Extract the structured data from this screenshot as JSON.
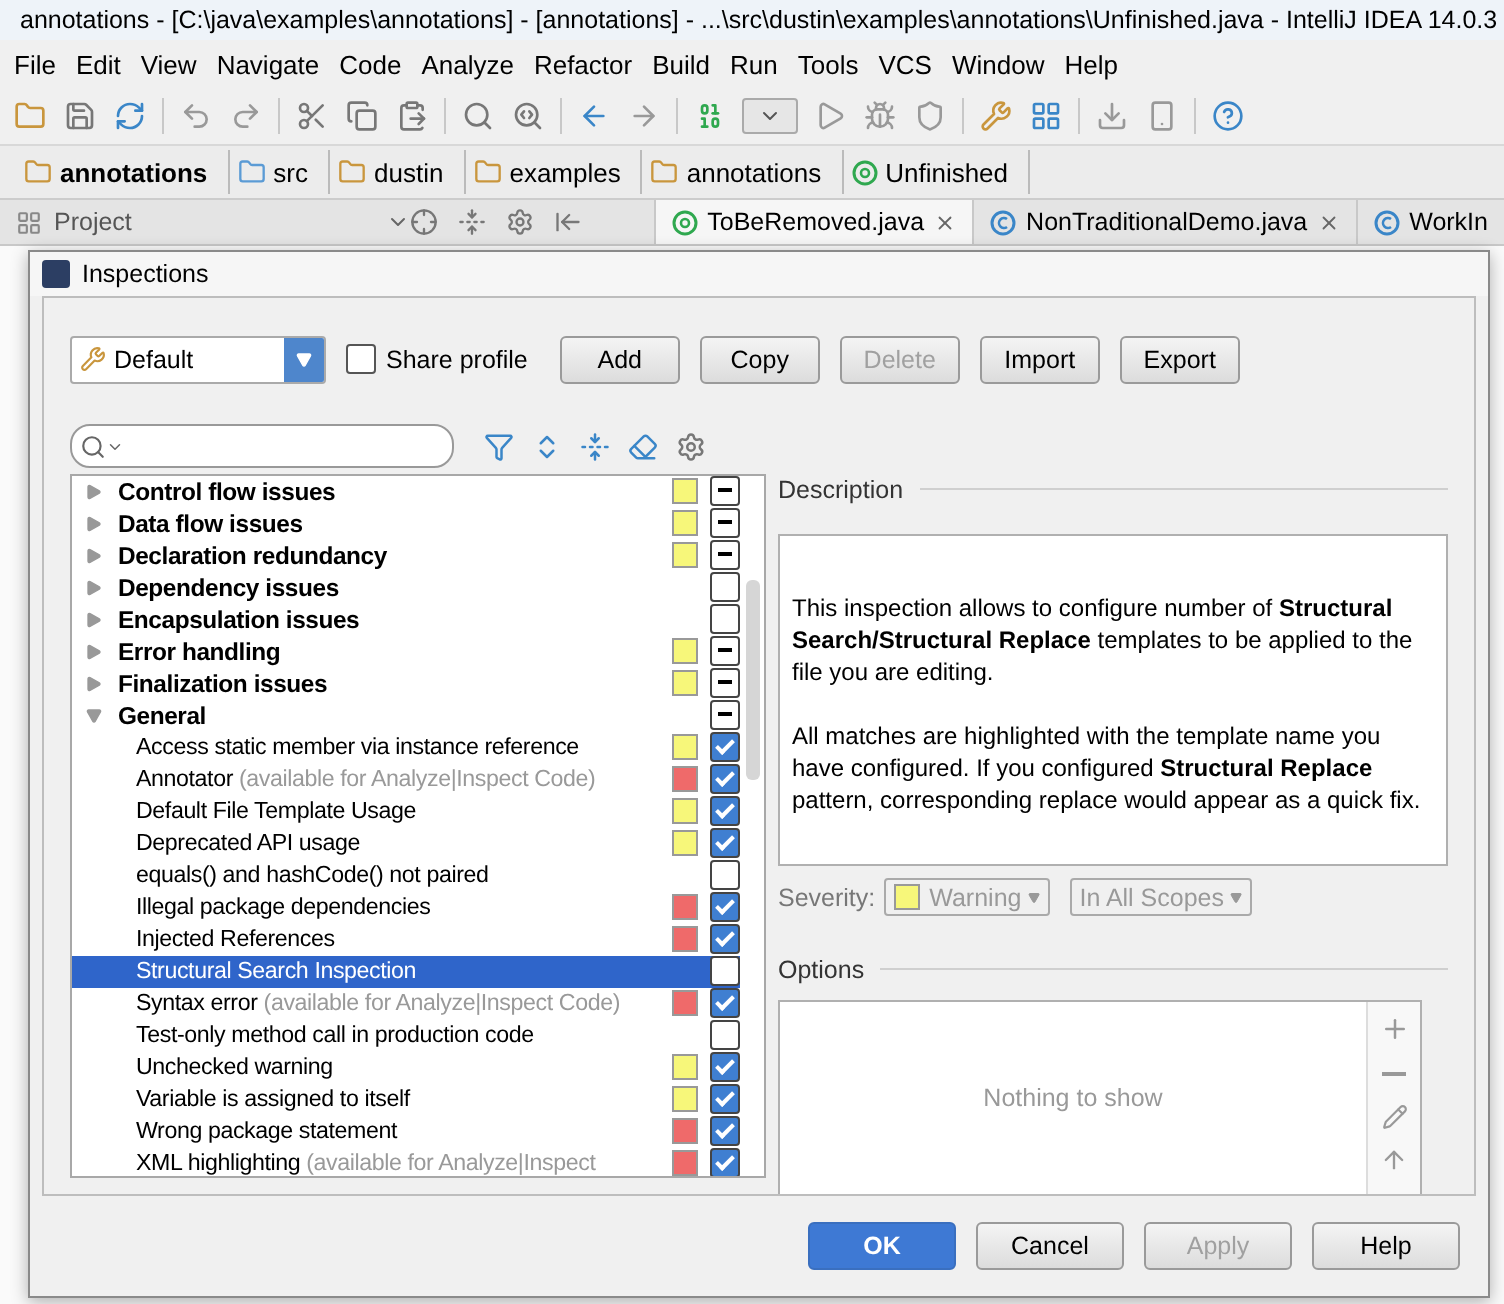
{
  "window": {
    "title": "annotations - [C:\\java\\examples\\annotations] - [annotations] - ...\\src\\dustin\\examples\\annotations\\Unfinished.java - IntelliJ IDEA 14.0.3"
  },
  "menu": [
    "File",
    "Edit",
    "View",
    "Navigate",
    "Code",
    "Analyze",
    "Refactor",
    "Build",
    "Run",
    "Tools",
    "VCS",
    "Window",
    "Help"
  ],
  "breadcrumbs": [
    {
      "label": "annotations",
      "kind": "module"
    },
    {
      "label": "src",
      "kind": "source"
    },
    {
      "label": "dustin",
      "kind": "package"
    },
    {
      "label": "examples",
      "kind": "package"
    },
    {
      "label": "annotations",
      "kind": "package"
    },
    {
      "label": "Unfinished",
      "kind": "annotation"
    }
  ],
  "tool_window": {
    "title": "Project"
  },
  "editor_tabs": [
    {
      "label": "ToBeRemoved.java",
      "kind": "annotation",
      "selected": true
    },
    {
      "label": "NonTraditionalDemo.java",
      "kind": "class",
      "selected": false
    },
    {
      "label": "WorkIn",
      "kind": "class",
      "selected": false
    }
  ],
  "dialog": {
    "title": "Inspections",
    "profile": {
      "value": "Default"
    },
    "share_profile": {
      "label": "Share profile",
      "checked": false
    },
    "buttons": [
      {
        "label": "Add",
        "disabled": false
      },
      {
        "label": "Copy",
        "disabled": false
      },
      {
        "label": "Delete",
        "disabled": true
      },
      {
        "label": "Import",
        "disabled": false
      },
      {
        "label": "Export",
        "disabled": false
      }
    ],
    "tree": [
      {
        "label": "Control flow issues",
        "expanded": false,
        "selected": false,
        "color": "#f7f77a",
        "mixed": true
      },
      {
        "label": "Data flow issues",
        "expanded": false,
        "selected": false,
        "color": "#f7f77a",
        "mixed": true
      },
      {
        "label": "Declaration redundancy",
        "expanded": false,
        "selected": false,
        "color": "#f7f77a",
        "mixed": true
      },
      {
        "label": "Dependency issues",
        "expanded": false,
        "selected": false,
        "mixed": false
      },
      {
        "label": "Encapsulation issues",
        "expanded": false,
        "selected": false,
        "mixed": false
      },
      {
        "label": "Error handling",
        "expanded": false,
        "selected": false,
        "color": "#f7f77a",
        "mixed": true
      },
      {
        "label": "Finalization issues",
        "expanded": false,
        "selected": false,
        "color": "#f7f77a",
        "mixed": true
      },
      {
        "label": "General",
        "expanded": true,
        "selected": false,
        "mixed": true,
        "children": [
          {
            "label": "Access static member via instance reference",
            "selected": false,
            "color": "#f7f77a",
            "checked": true
          },
          {
            "label": "Annotator",
            "note": "(available for Analyze|Inspect Code)",
            "selected": false,
            "color": "#ef6a6a",
            "checked": true
          },
          {
            "label": "Default File Template Usage",
            "selected": false,
            "color": "#f7f77a",
            "checked": true
          },
          {
            "label": "Deprecated API usage",
            "selected": false,
            "color": "#f7f77a",
            "checked": true
          },
          {
            "label": "equals() and hashCode() not paired",
            "selected": false,
            "checked": false
          },
          {
            "label": "Illegal package dependencies",
            "selected": false,
            "color": "#ef6a6a",
            "checked": true
          },
          {
            "label": "Injected References",
            "selected": false,
            "color": "#ef6a6a",
            "checked": true
          },
          {
            "label": "Structural Search Inspection",
            "selected": true,
            "checked": false
          },
          {
            "label": "Syntax error",
            "note": "(available for Analyze|Inspect Code)",
            "selected": false,
            "color": "#ef6a6a",
            "checked": true
          },
          {
            "label": "Test-only method call in production code",
            "selected": false,
            "checked": false
          },
          {
            "label": "Unchecked warning",
            "selected": false,
            "color": "#f7f77a",
            "checked": true
          },
          {
            "label": "Variable is assigned to itself",
            "selected": false,
            "color": "#f7f77a",
            "checked": true
          },
          {
            "label": "Wrong package statement",
            "selected": false,
            "color": "#ef6a6a",
            "checked": true
          },
          {
            "label": "XML highlighting",
            "note": "(available for Analyze|Inspect",
            "selected": false,
            "color": "#ef6a6a",
            "checked": true
          }
        ]
      }
    ],
    "description": {
      "heading": "Description",
      "paragraphs": [
        "This inspection allows to configure number of **Structural Search/Structural Replace** templates to be applied to the file you are editing.",
        "All matches are highlighted with the template name you have configured. If you configured **Structural Replace** pattern, corresponding replace would appear as a quick fix."
      ]
    },
    "severity": {
      "label": "Severity:",
      "value": "Warning",
      "color": "#f7f77a",
      "disabled": true
    },
    "scope": {
      "value": "In All Scopes",
      "disabled": true
    },
    "options": {
      "heading": "Options",
      "empty_text": "Nothing to show"
    },
    "footer_buttons": [
      {
        "label": "OK",
        "primary": true,
        "disabled": false
      },
      {
        "label": "Cancel",
        "primary": false,
        "disabled": false
      },
      {
        "label": "Apply",
        "primary": false,
        "disabled": true
      },
      {
        "label": "Help",
        "primary": false,
        "disabled": false
      }
    ]
  }
}
